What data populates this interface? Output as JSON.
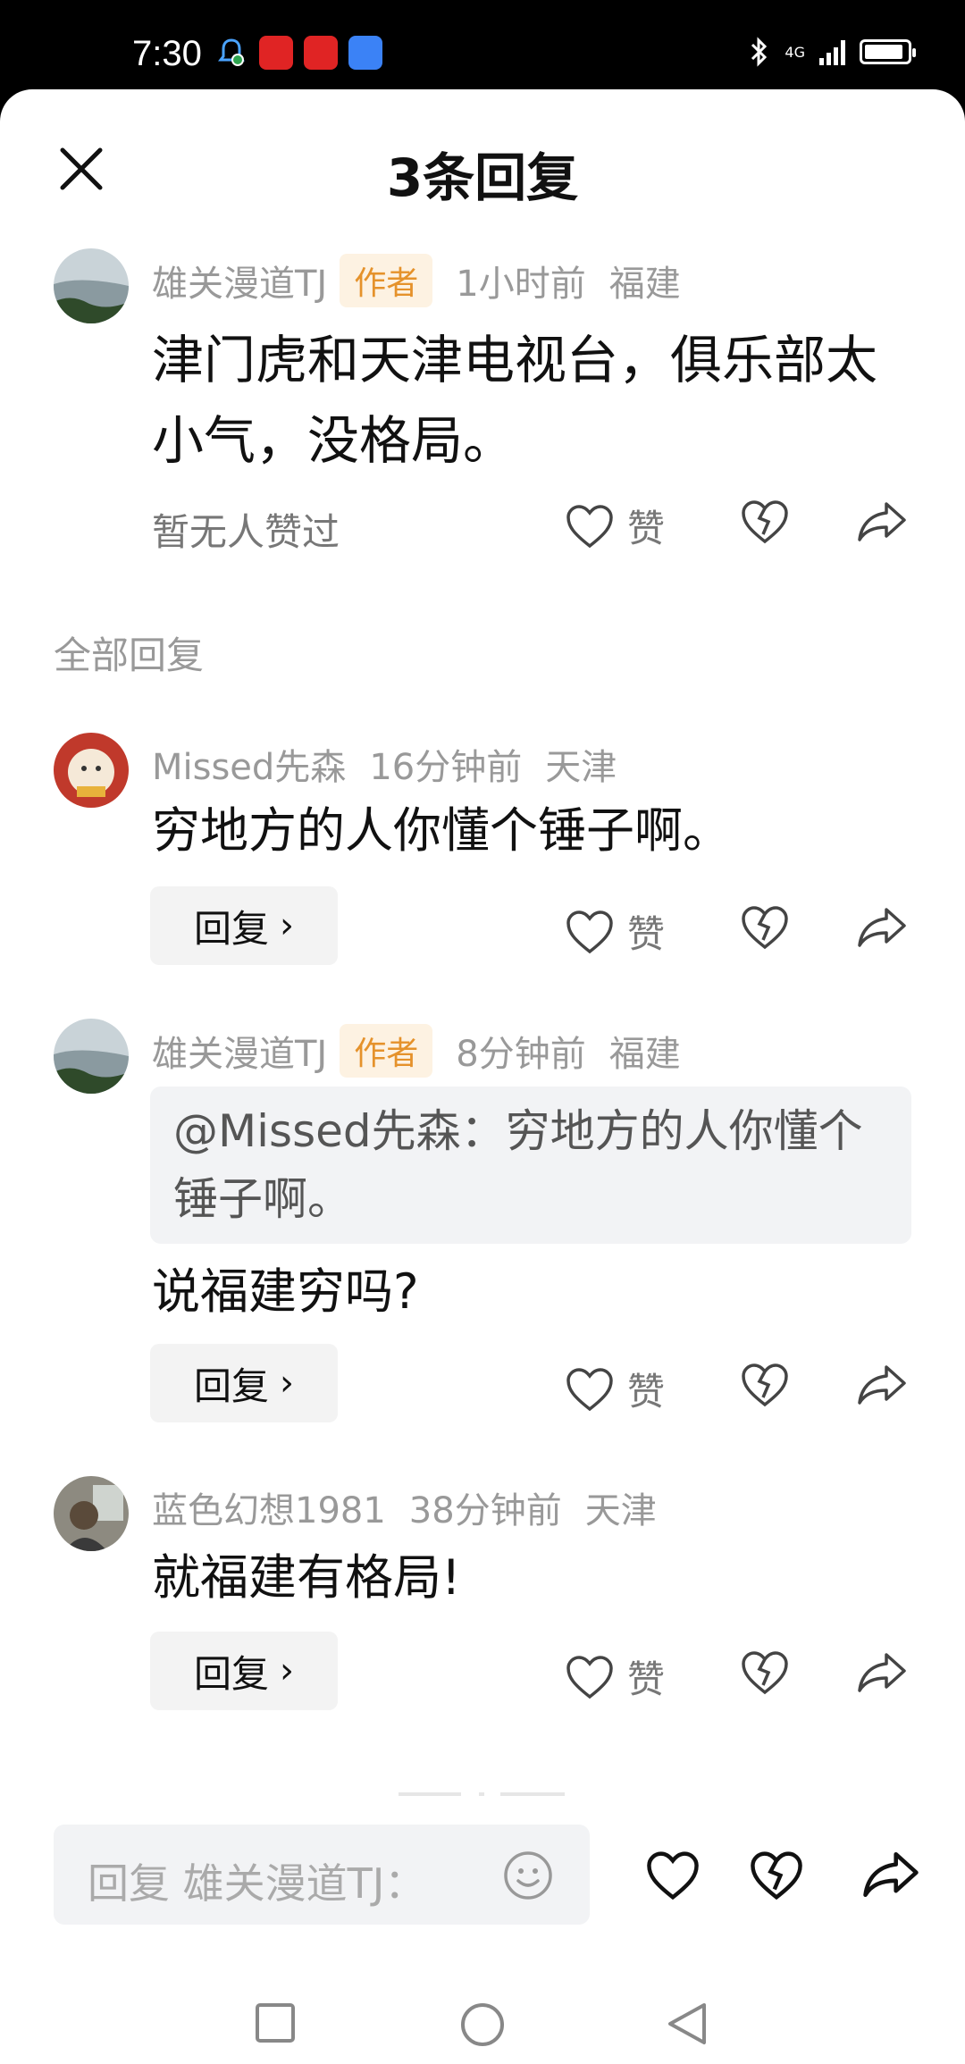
{
  "status_bar": {
    "time": "7:30",
    "network": "4G"
  },
  "sheet": {
    "title": "3条回复"
  },
  "main_comment": {
    "username": "雄关漫道TJ",
    "author_badge": "作者",
    "time": "1小时前",
    "location": "福建",
    "text": "津门虎和天津电视台，俱乐部太小气，没格局。",
    "no_likes_text": "暂无人赞过",
    "like_label": "赞"
  },
  "section_label": "全部回复",
  "replies": [
    {
      "username": "Missed先森",
      "time": "16分钟前",
      "location": "天津",
      "text": "穷地方的人你懂个锤子啊。",
      "reply_label": "回复",
      "like_label": "赞"
    },
    {
      "username": "雄关漫道TJ",
      "author_badge": "作者",
      "time": "8分钟前",
      "location": "福建",
      "quote": "@Missed先森：穷地方的人你懂个锤子啊。",
      "text": "说福建穷吗?",
      "reply_label": "回复",
      "like_label": "赞"
    },
    {
      "username": "蓝色幻想1981",
      "time": "38分钟前",
      "location": "天津",
      "text": "就福建有格局!",
      "reply_label": "回复",
      "like_label": "赞"
    }
  ],
  "composer": {
    "placeholder": "回复 雄关漫道TJ："
  },
  "colors": {
    "author_badge_bg": "#fdf2e2",
    "author_badge_text": "#e5922b",
    "meta": "#999999"
  }
}
